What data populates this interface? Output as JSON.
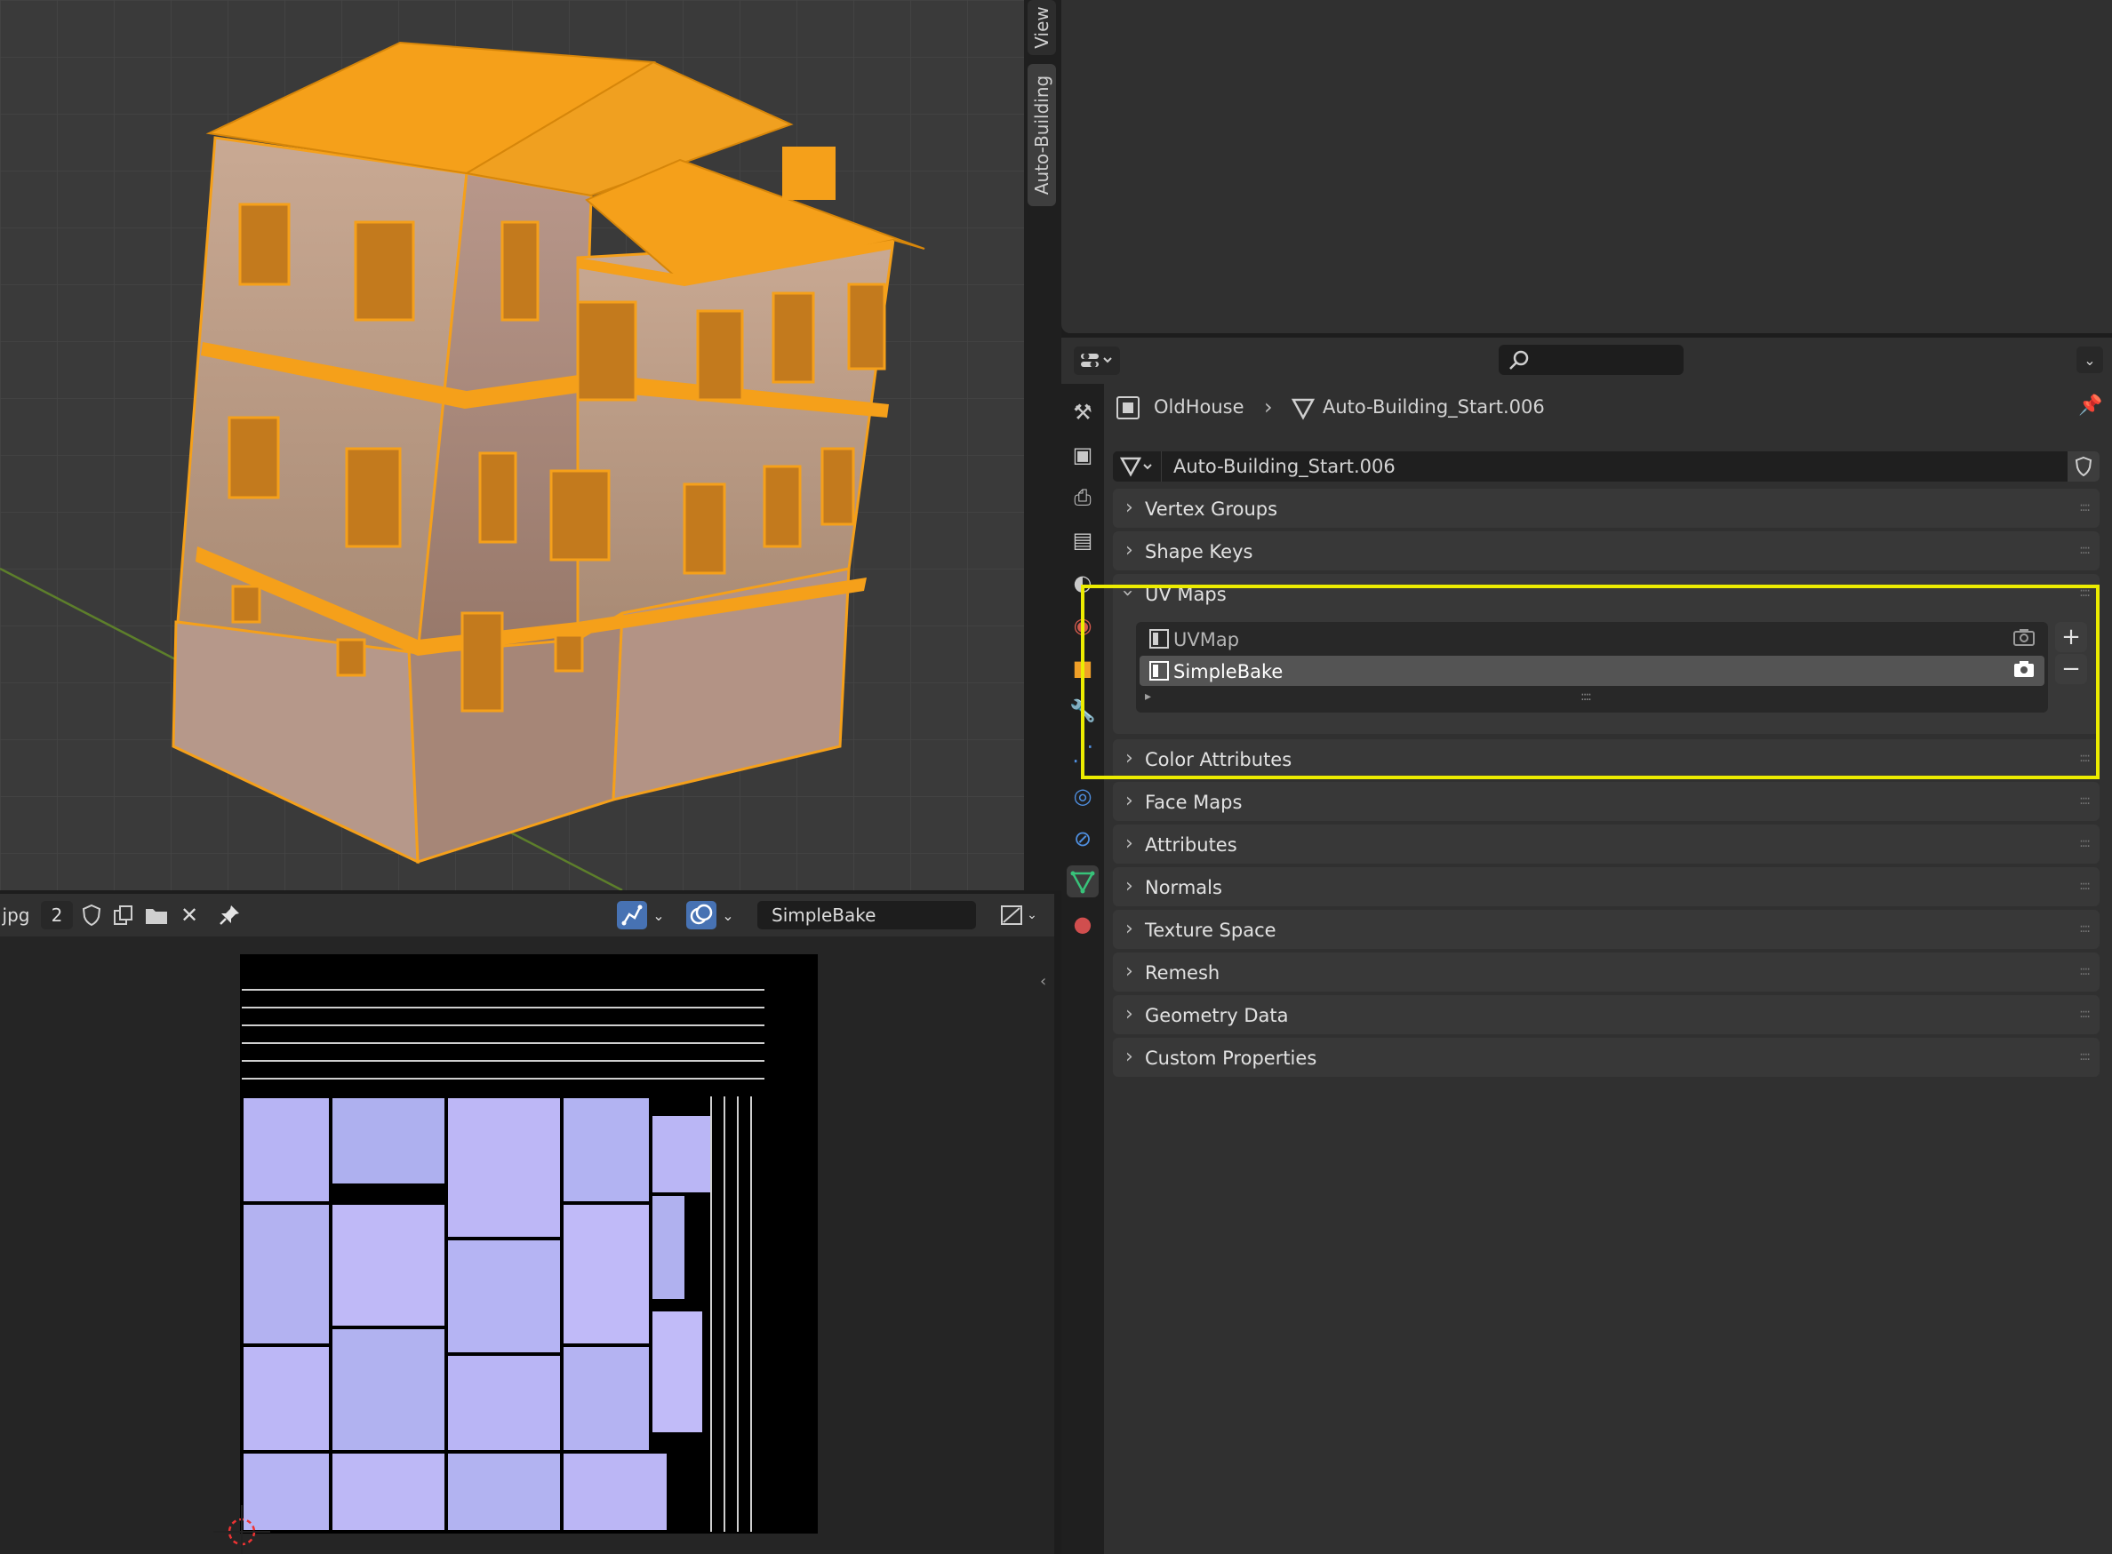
{
  "colors": {
    "selection_orange": "#f5a01a",
    "highlight_yellow": "#ecec00",
    "active_blue": "#4772b3",
    "uv_texture": "#b7b4f4"
  },
  "side_tabs": {
    "view": "View",
    "auto_building": "Auto-Building"
  },
  "uv_header": {
    "image_name_suffix": "jpg",
    "users_count": "2",
    "uv_map_name": "SimpleBake",
    "icons": [
      "fake-user-shield-icon",
      "duplicate-icon",
      "open-folder-icon",
      "close-icon",
      "pin-icon",
      "uv-sync-icon",
      "overlay-icon",
      "image-mode-icon"
    ]
  },
  "properties": {
    "breadcrumb": {
      "object": "OldHouse",
      "separator": "›",
      "mesh": "Auto-Building_Start.006"
    },
    "mesh_datablock": "Auto-Building_Start.006",
    "tabs": [
      "tool-icon",
      "render-icon",
      "output-icon",
      "view-layer-icon",
      "scene-icon",
      "world-icon",
      "object-icon",
      "modifier-icon",
      "particles-icon",
      "physics-icon",
      "constraints-icon",
      "data-icon",
      "material-icon"
    ],
    "panels": {
      "vertex_groups": "Vertex Groups",
      "shape_keys": "Shape Keys",
      "uv_maps": "UV Maps",
      "color_attributes": "Color Attributes",
      "face_maps": "Face Maps",
      "attributes": "Attributes",
      "normals": "Normals",
      "texture_space": "Texture Space",
      "remesh": "Remesh",
      "geometry_data": "Geometry Data",
      "custom_properties": "Custom Properties"
    },
    "uv_maps": [
      {
        "name": "UVMap",
        "active_render": false,
        "selected": false
      },
      {
        "name": "SimpleBake",
        "active_render": true,
        "selected": true
      }
    ],
    "list_add": "+",
    "list_remove": "−",
    "list_grip": "::::",
    "expanded_arrow": "▸"
  }
}
